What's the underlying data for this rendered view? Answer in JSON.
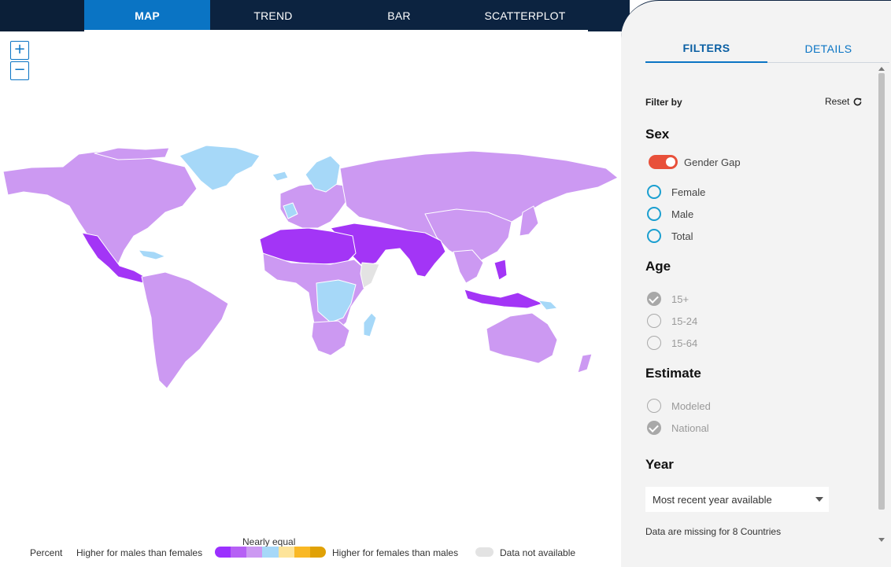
{
  "tabs": [
    {
      "label": "MAP",
      "active": true
    },
    {
      "label": "TREND",
      "active": false
    },
    {
      "label": "BAR",
      "active": false
    },
    {
      "label": "SCATTERPLOT",
      "active": false
    }
  ],
  "zoom": {
    "in_label": "+",
    "out_label": "−"
  },
  "legend": {
    "percent_label": "Percent",
    "left_label": "Higher for males than females",
    "center_label": "Nearly equal",
    "right_label": "Higher for females than males",
    "na_label": "Data not available",
    "swatches": [
      "#9b30ff",
      "#b660f5",
      "#cc99f2",
      "#a6d8f8",
      "#fde49a",
      "#f9b825",
      "#e0a106"
    ],
    "na_color": "#e3e3e3"
  },
  "colors": {
    "accent": "#0a74c4",
    "nav_bg": "#0c2340",
    "toggle_on": "#e8503a",
    "map_light_purple": "#cc99f2",
    "map_dark_purple": "#a335f6",
    "map_light_blue": "#a6d8f8",
    "map_na": "#e3e3e3"
  },
  "panel": {
    "tabs": [
      {
        "label": "FILTERS",
        "active": true
      },
      {
        "label": "DETAILS",
        "active": false
      }
    ],
    "filter_by": "Filter by",
    "reset_label": "Reset",
    "sex": {
      "title": "Sex",
      "toggle_label": "Gender Gap",
      "toggle_on": true,
      "options": [
        "Female",
        "Male",
        "Total"
      ]
    },
    "age": {
      "title": "Age",
      "options": [
        {
          "label": "15+",
          "checked": true
        },
        {
          "label": "15-24",
          "checked": false
        },
        {
          "label": "15-64",
          "checked": false
        }
      ]
    },
    "estimate": {
      "title": "Estimate",
      "options": [
        {
          "label": "Modeled",
          "checked": false
        },
        {
          "label": "National",
          "checked": true
        }
      ]
    },
    "year": {
      "title": "Year",
      "selected": "Most recent year available"
    },
    "missing_note": "Data are missing for 8 Countries"
  }
}
